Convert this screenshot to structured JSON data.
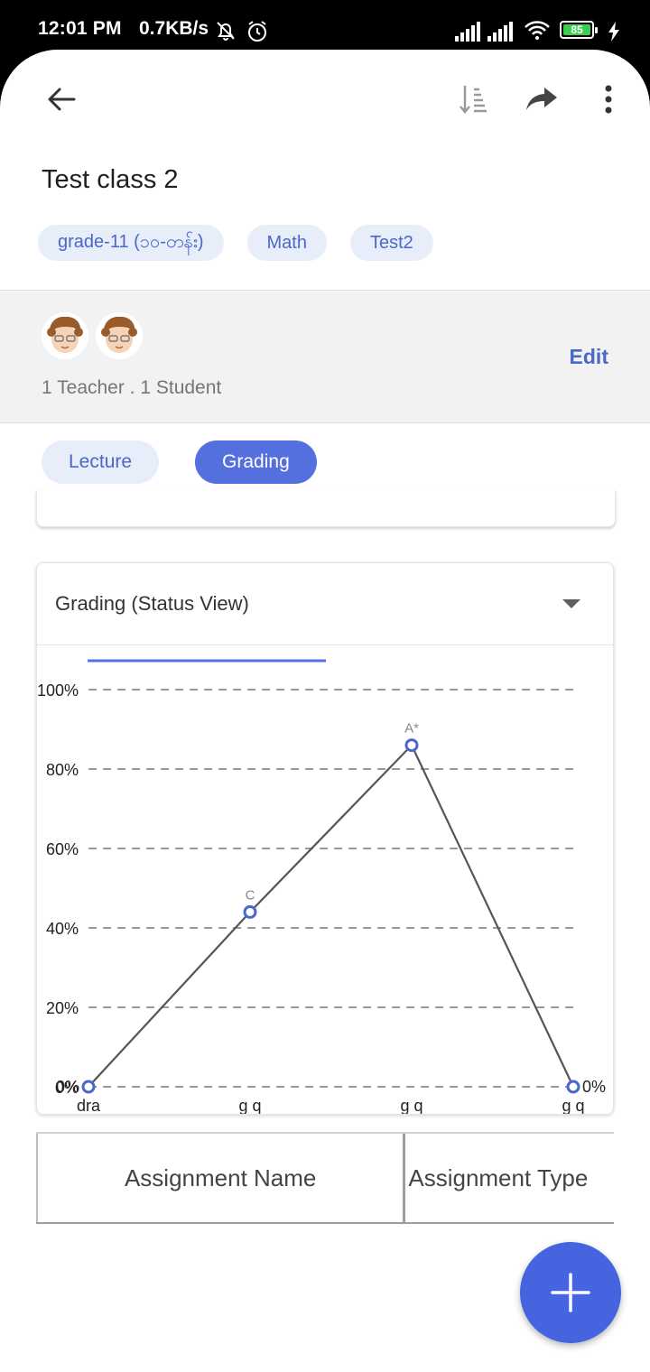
{
  "status_bar": {
    "time": "12:01 PM",
    "net_speed": "0.7KB/s",
    "battery_level": "85"
  },
  "toolbar": {
    "back_icon": "arrow-back-icon",
    "sort_icon": "sort-icon",
    "share_icon": "share-icon",
    "more_icon": "more-vert-icon"
  },
  "class": {
    "title": "Test class 2",
    "tags": [
      "grade-11 (၁၀-တန်း)",
      "Math",
      "Test2"
    ]
  },
  "members": {
    "summary": "1 Teacher . 1 Student",
    "edit_label": "Edit"
  },
  "tabs": [
    {
      "label": "Lecture",
      "active": false
    },
    {
      "label": "Grading",
      "active": true
    }
  ],
  "grading_card": {
    "view_label": "Grading (Status View)"
  },
  "chart_data": {
    "type": "line",
    "categories": [
      "dra",
      "g q",
      "g q",
      "g q"
    ],
    "values": [
      0,
      44,
      86,
      0
    ],
    "point_labels": [
      "0%",
      "C",
      "A*",
      "0%"
    ],
    "ylim": [
      0,
      100
    ],
    "y_ticks": [
      "0%",
      "20%",
      "40%",
      "60%",
      "80%",
      "100%"
    ],
    "grid": true,
    "line_color": "#555555",
    "marker_color": "#4a67c9",
    "legend_color": "#5470df"
  },
  "table": {
    "headers": [
      "Assignment Name",
      "Assignment Type"
    ]
  },
  "fab": {
    "icon": "plus-icon"
  }
}
